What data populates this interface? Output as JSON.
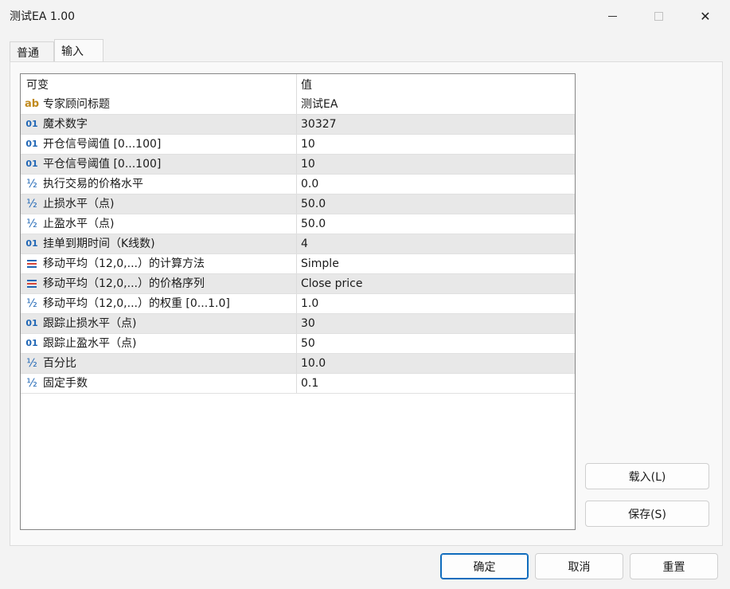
{
  "window": {
    "title": "测试EA 1.00",
    "min_glyph": "",
    "close_glyph": "✕"
  },
  "tabs": [
    {
      "label": "普通",
      "active": false
    },
    {
      "label": "输入",
      "active": true
    }
  ],
  "grid": {
    "headers": [
      "可变",
      "值"
    ],
    "rows": [
      {
        "icon": "ab",
        "type": "string",
        "name": "专家顾问标题",
        "value": "测试EA"
      },
      {
        "icon": "01",
        "type": "integer",
        "name": "魔术数字",
        "value": "30327"
      },
      {
        "icon": "01",
        "type": "integer",
        "name": "开仓信号阈值 [0...100]",
        "value": "10"
      },
      {
        "icon": "01",
        "type": "integer",
        "name": "平仓信号阈值 [0...100]",
        "value": "10"
      },
      {
        "icon": "½",
        "type": "double",
        "name": "执行交易的价格水平",
        "value": "0.0"
      },
      {
        "icon": "½",
        "type": "double",
        "name": "止损水平（点)",
        "value": "50.0"
      },
      {
        "icon": "½",
        "type": "double",
        "name": "止盈水平（点)",
        "value": "50.0"
      },
      {
        "icon": "01",
        "type": "integer",
        "name": "挂单到期时间（K线数)",
        "value": "4"
      },
      {
        "icon": "enum",
        "type": "enum",
        "name": "移动平均（12,0,...）的计算方法",
        "value": "Simple"
      },
      {
        "icon": "enum",
        "type": "enum",
        "name": "移动平均（12,0,...）的价格序列",
        "value": "Close price"
      },
      {
        "icon": "½",
        "type": "double",
        "name": "移动平均（12,0,...）的权重 [0...1.0]",
        "value": "1.0"
      },
      {
        "icon": "01",
        "type": "integer",
        "name": "跟踪止损水平（点)",
        "value": "30"
      },
      {
        "icon": "01",
        "type": "integer",
        "name": "跟踪止盈水平（点)",
        "value": "50"
      },
      {
        "icon": "½",
        "type": "double",
        "name": "百分比",
        "value": "10.0"
      },
      {
        "icon": "½",
        "type": "double",
        "name": "固定手数",
        "value": "0.1"
      }
    ]
  },
  "side_buttons": {
    "load": "载入(L)",
    "save": "保存(S)"
  },
  "footer_buttons": {
    "ok": "确定",
    "cancel": "取消",
    "reset": "重置"
  },
  "colors": {
    "string_icon": "#c08a1e",
    "number_icon": "#1f66b5",
    "accent": "#0f6cbd",
    "alt_row": "#e8e8e8"
  }
}
